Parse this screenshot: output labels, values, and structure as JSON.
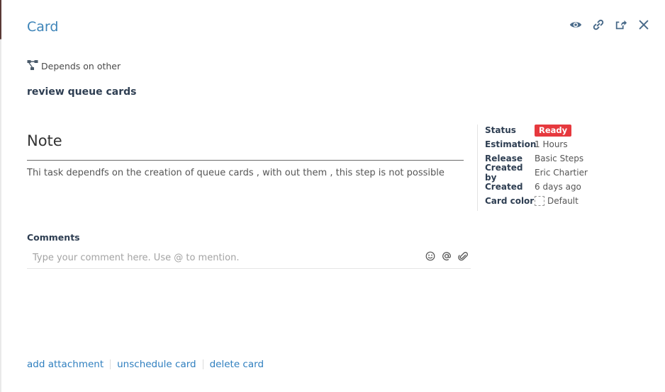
{
  "header": {
    "title": "Card",
    "icons": [
      "eye-icon",
      "link-icon",
      "share-icon",
      "close-icon"
    ]
  },
  "dependency": {
    "icon": "dependency-icon",
    "label": "Depends on other"
  },
  "card": {
    "subject": "review queue cards"
  },
  "note": {
    "title": "Note",
    "text": "Thi task dependfs on the creation of queue cards , with out them , this step is not possible"
  },
  "properties": {
    "status_label": "Status",
    "status_value": "Ready",
    "status_color": "#e6393e",
    "estimation_label": "Estimation",
    "estimation_value": "1 Hours",
    "release_label": "Release",
    "release_value": "Basic Steps",
    "created_by_label": "Created by",
    "created_by_value": "Eric Chartier",
    "created_label": "Created",
    "created_value": "6 days ago",
    "card_color_label": "Card color",
    "card_color_value": "Default"
  },
  "comments": {
    "label": "Comments",
    "placeholder": "Type your comment here. Use @ to mention.",
    "value": "",
    "icons": [
      "emoji-icon",
      "mention-icon",
      "attachment-icon"
    ]
  },
  "footer": {
    "add_attachment": "add attachment",
    "unschedule_card": "unschedule card",
    "delete_card": "delete card"
  },
  "colors": {
    "accent": "#3d84b8",
    "link": "#2f7fbf",
    "icon": "#4a6b8a"
  }
}
